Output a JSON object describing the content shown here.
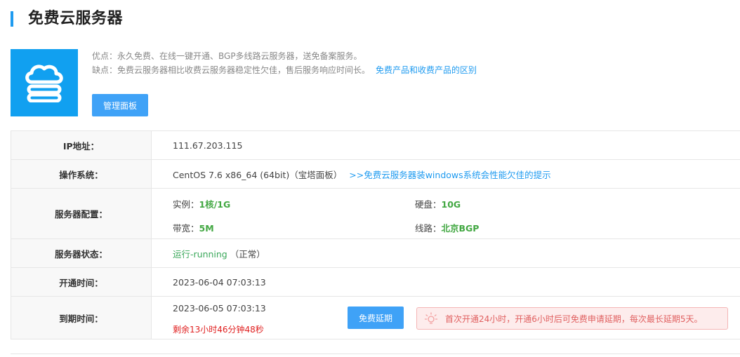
{
  "page": {
    "title": "免费云服务器"
  },
  "intro": {
    "cloud_icon": "cloud-server-icon",
    "pros": "优点：永久免费、在线一键开通、BGP多线路云服务器，送免备案服务。",
    "cons": "缺点：免费云服务器相比收费云服务器稳定性欠佳，售后服务响应时间长。",
    "compare_link": "免费产品和收费产品的区别",
    "manage_button": "管理面板"
  },
  "info": {
    "ip": {
      "label": "IP地址：",
      "value": "111.67.203.115"
    },
    "os": {
      "label": "操作系统：",
      "value": "CentOS 7.6 x86_64 (64bit)（宝塔面板）",
      "link": ">>免费云服务器装windows系统会性能欠佳的提示"
    },
    "config": {
      "label": "服务器配置：",
      "instance_label": "实例：",
      "instance_value": "1核/1G",
      "disk_label": "硬盘：",
      "disk_value": "10G",
      "bandwidth_label": "带宽：",
      "bandwidth_value": "5M",
      "line_label": "线路：",
      "line_value": "北京BGP"
    },
    "status": {
      "label": "服务器状态：",
      "value": "运行-running",
      "note": "（正常）"
    },
    "open_time": {
      "label": "开通时间：",
      "value": "2023-06-04 07:03:13"
    },
    "expire_time": {
      "label": "到期时间：",
      "value": "2023-06-05 07:03:13",
      "remaining": "剩余13小时46分钟48秒",
      "extend_button": "免费延期",
      "tip": "首次开通24小时，开通6小时后可免费申请延期，每次最长延期5天。",
      "tip_icon": "lightbulb-icon"
    }
  },
  "colors": {
    "accent": "#1f9bf0",
    "button": "#3fa2f7",
    "success": "#43a843",
    "danger": "#e02020",
    "tip_bg": "#fdecec"
  }
}
